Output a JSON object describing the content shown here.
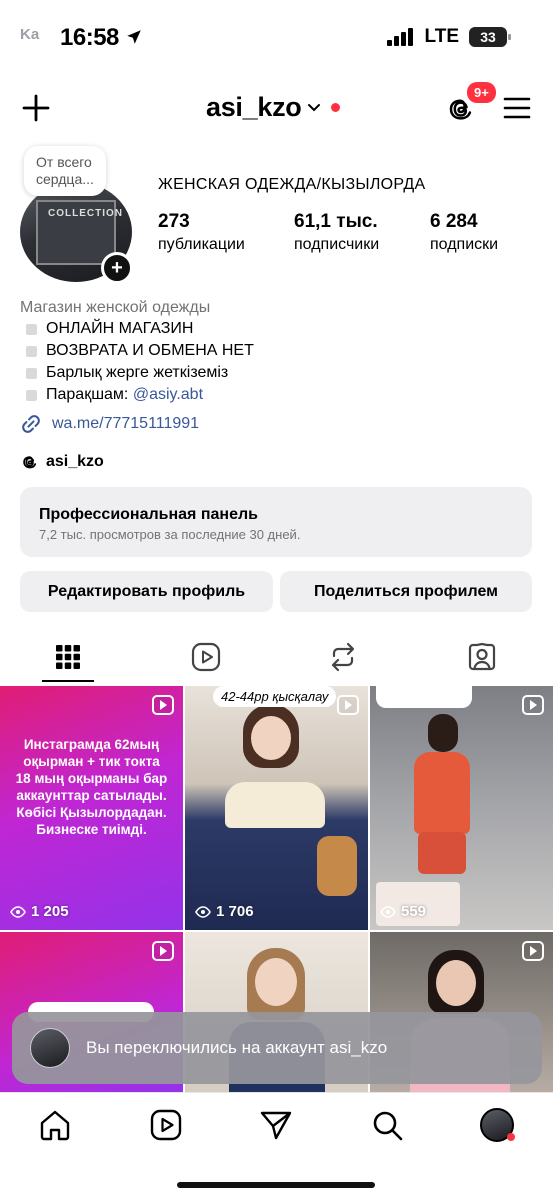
{
  "status_bar": {
    "time": "16:58",
    "back_app": "Ka",
    "network": "LTE",
    "battery": "33"
  },
  "header": {
    "username": "asi_kzo",
    "notification_badge": "9+"
  },
  "profile": {
    "note": [
      "От всего",
      "сердца..."
    ],
    "display_name": "ЖЕНСКАЯ ОДЕЖДА/КЫЗЫЛОРДА",
    "stats": [
      {
        "value": "273",
        "label": "публикации"
      },
      {
        "value": "61,1 тыс.",
        "label": "подписчики"
      },
      {
        "value": "6 284",
        "label": "подписки"
      }
    ],
    "category": "Магазин женской одежды",
    "bio_lines": [
      {
        "text": "ОНЛАЙН МАГАЗИН"
      },
      {
        "text": "ВОЗВРАТА И ОБМЕНА НЕТ"
      },
      {
        "text": "Барлық жерге жеткіземіз"
      },
      {
        "text": "Парақшам: ",
        "mention": "@asiy.abt"
      }
    ],
    "link": "wa.me/77715111991",
    "threads_handle": "asi_kzo"
  },
  "professional_panel": {
    "title": "Профессиональная панель",
    "subtitle": "7,2 тыс. просмотров за последние 30 дней."
  },
  "buttons": {
    "edit": "Редактировать профиль",
    "share": "Поделиться профилем"
  },
  "tabs": [
    "grid",
    "reels",
    "reposts",
    "tagged"
  ],
  "grid": [
    {
      "type": "promo",
      "text": "Инстаграмда 62мың оқырман + тик токта 18 мың оқырманы бар аккаунттар сатылады. Көбісі Қызылордадан. Бизнеске тиімді.",
      "views": "1 205",
      "color": "#c026d3"
    },
    {
      "type": "photo",
      "caption": "42-44рр қысқалау",
      "views": "1 706"
    },
    {
      "type": "photo",
      "views": "559"
    },
    {
      "type": "photo"
    },
    {
      "type": "photo"
    },
    {
      "type": "photo"
    }
  ],
  "toast": {
    "text": "Вы переключились на аккаунт asi_kzo"
  },
  "colors": {
    "accent_red": "#ff3040",
    "link_blue": "#385898",
    "panel_bg": "#efeff1"
  }
}
